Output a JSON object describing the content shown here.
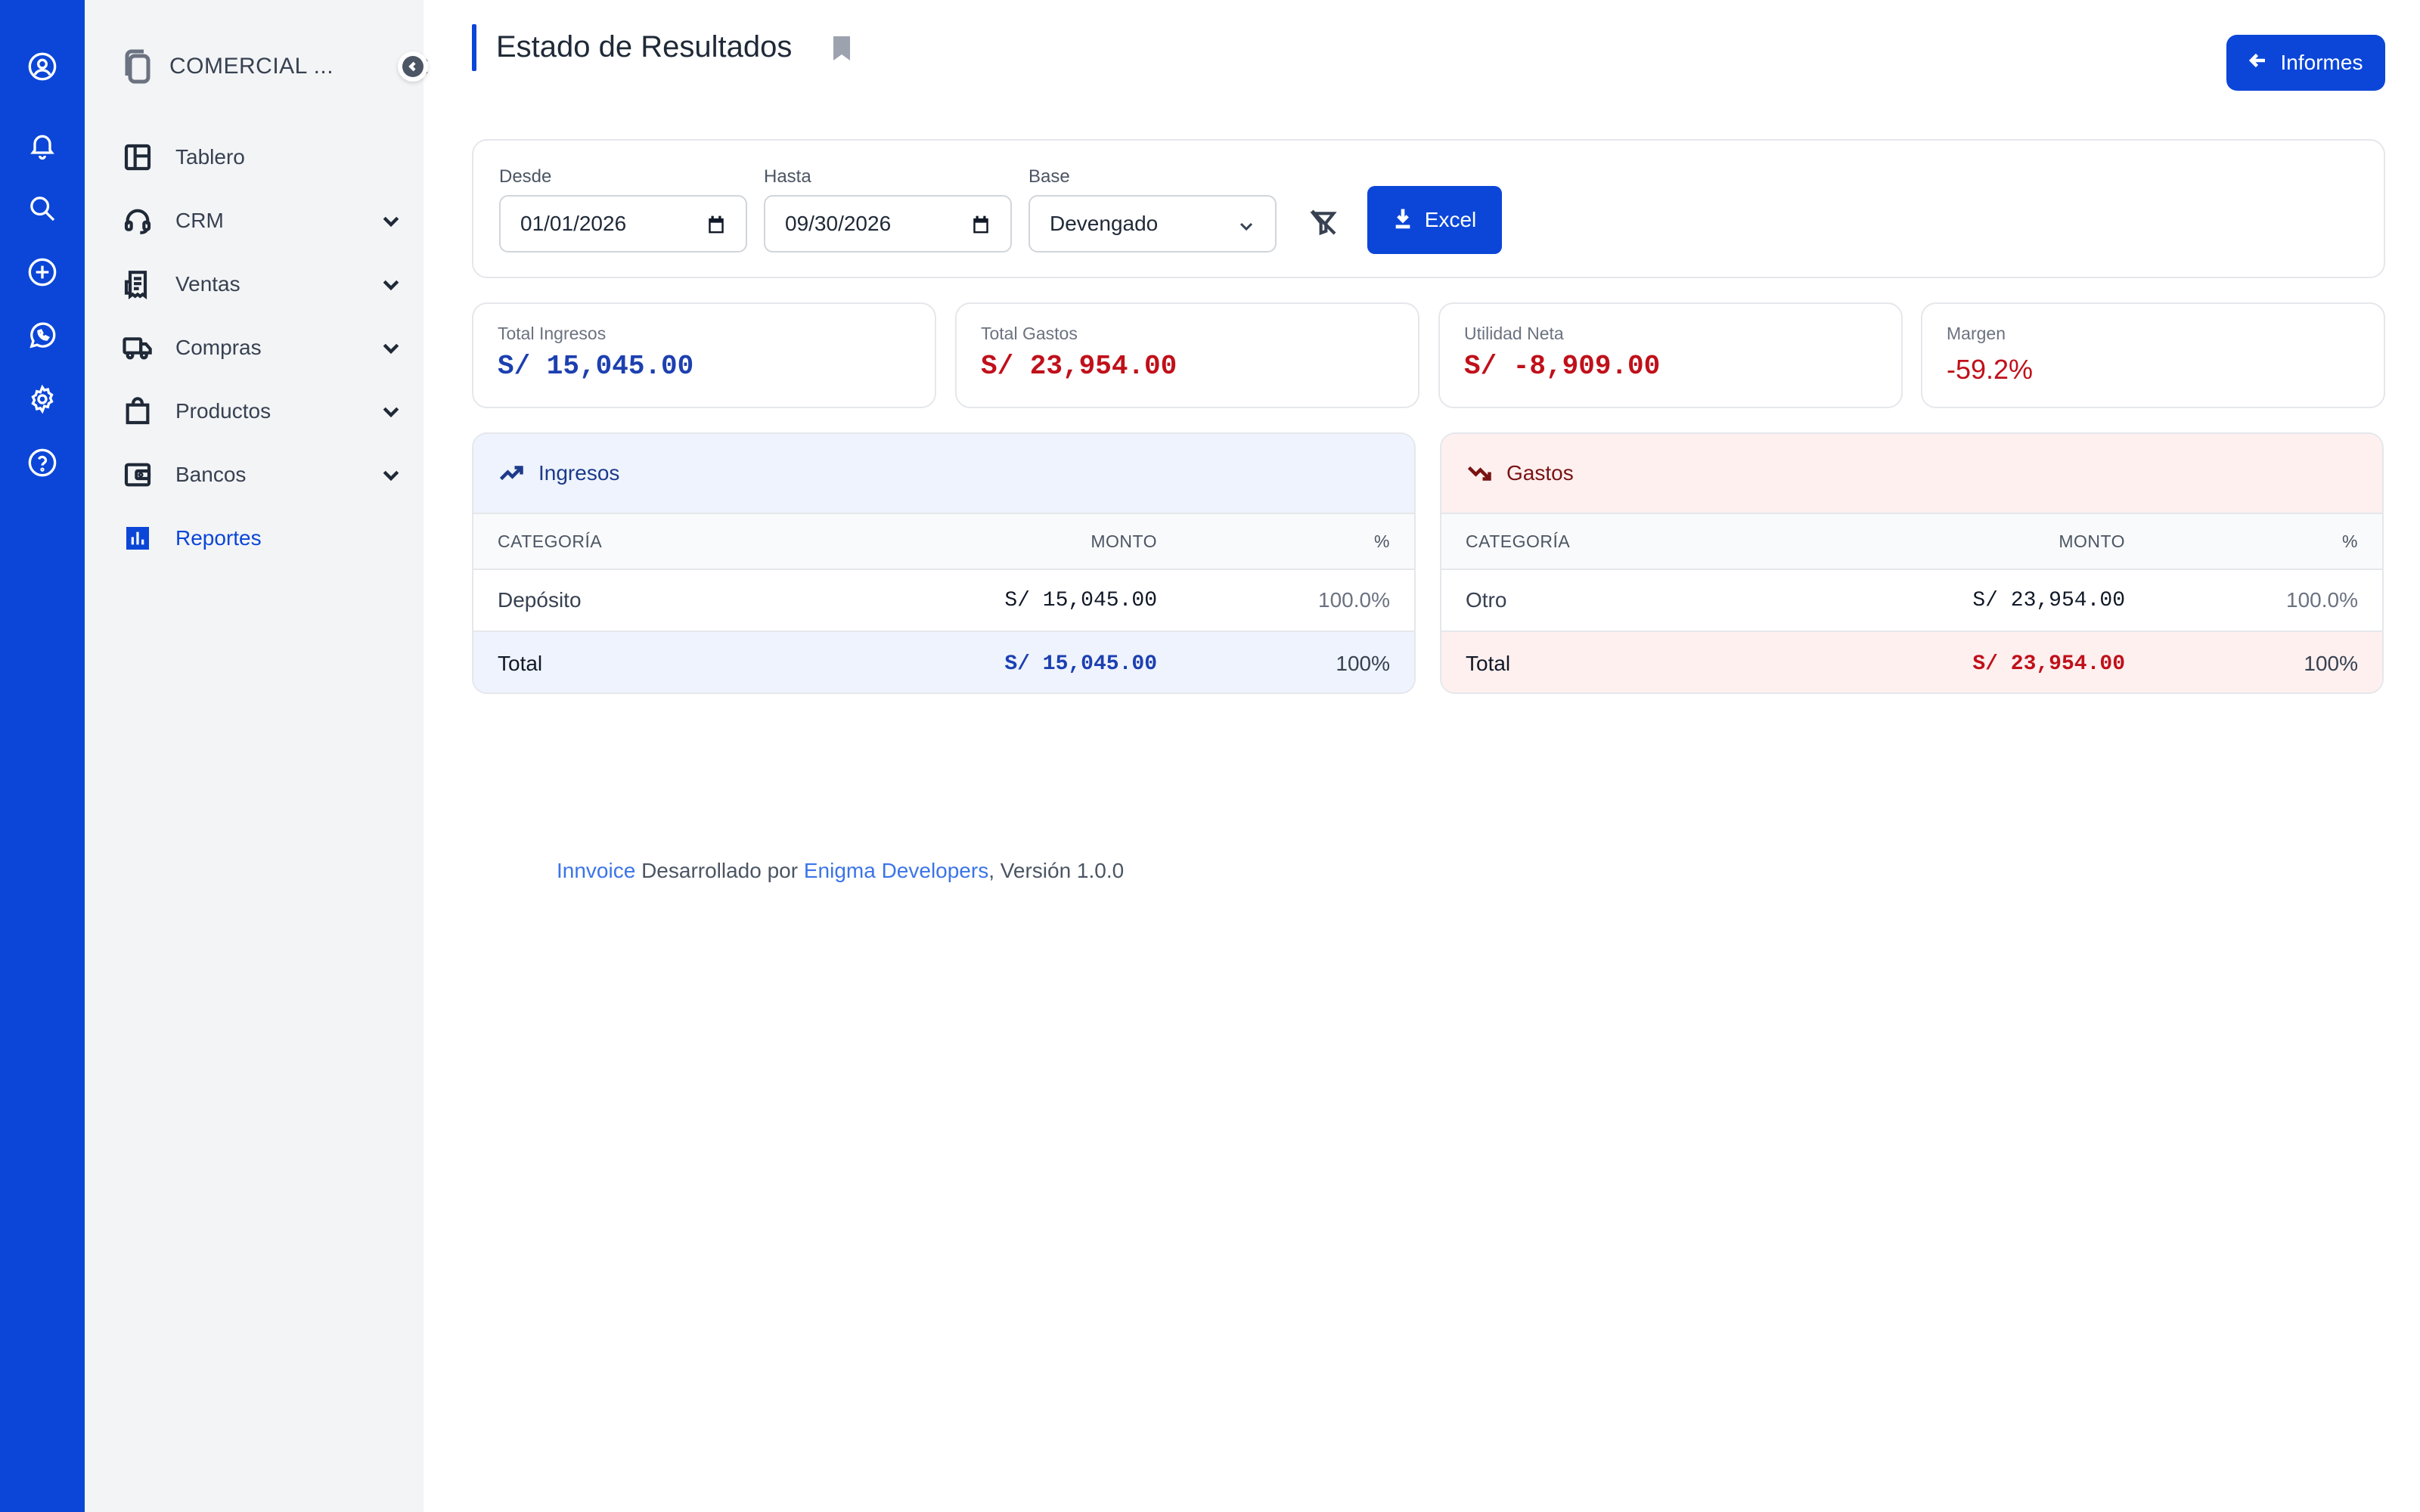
{
  "colors": {
    "brand": "#0b46d8",
    "income": "#1d40b0",
    "expense": "#c0101a",
    "income_bg": "#eef3fd",
    "expense_bg": "#fdf0ef"
  },
  "rail": {
    "icons": [
      "user-circle-icon",
      "bell-icon",
      "search-icon",
      "plus-circle-icon",
      "whatsapp-icon",
      "gear-icon",
      "help-circle-icon"
    ]
  },
  "sidebar": {
    "company": "COMERCIAL ...",
    "items": [
      {
        "label": "Tablero",
        "icon": "layout-icon",
        "expandable": false
      },
      {
        "label": "CRM",
        "icon": "headset-icon",
        "expandable": true
      },
      {
        "label": "Ventas",
        "icon": "receipt-icon",
        "expandable": true
      },
      {
        "label": "Compras",
        "icon": "truck-icon",
        "expandable": true
      },
      {
        "label": "Productos",
        "icon": "shopping-bag-icon",
        "expandable": true
      },
      {
        "label": "Bancos",
        "icon": "wallet-icon",
        "expandable": true
      },
      {
        "label": "Reportes",
        "icon": "bar-chart-icon",
        "expandable": false,
        "active": true
      }
    ]
  },
  "header": {
    "title": "Estado de Resultados",
    "back_button": "Informes"
  },
  "filters": {
    "desde_label": "Desde",
    "desde_value": "01/01/2026",
    "hasta_label": "Hasta",
    "hasta_value": "09/30/2026",
    "base_label": "Base",
    "base_value": "Devengado",
    "excel_button": "Excel"
  },
  "kpis": {
    "ingresos": {
      "label": "Total Ingresos",
      "value": "S/ 15,045.00"
    },
    "gastos": {
      "label": "Total Gastos",
      "value": "S/ 23,954.00"
    },
    "utilidad": {
      "label": "Utilidad Neta",
      "value": "S/ -8,909.00"
    },
    "margen": {
      "label": "Margen",
      "value": "-59.2%"
    }
  },
  "ingresos_table": {
    "title": "Ingresos",
    "headers": {
      "categoria": "CATEGORÍA",
      "monto": "MONTO",
      "pct": "%"
    },
    "rows": [
      {
        "categoria": "Depósito",
        "monto": "S/ 15,045.00",
        "pct": "100.0%"
      }
    ],
    "total": {
      "label": "Total",
      "monto": "S/ 15,045.00",
      "pct": "100%"
    }
  },
  "gastos_table": {
    "title": "Gastos",
    "headers": {
      "categoria": "CATEGORÍA",
      "monto": "MONTO",
      "pct": "%"
    },
    "rows": [
      {
        "categoria": "Otro",
        "monto": "S/ 23,954.00",
        "pct": "100.0%"
      }
    ],
    "total": {
      "label": "Total",
      "monto": "S/ 23,954.00",
      "pct": "100%"
    }
  },
  "footer": {
    "app_link": "Innvoice",
    "developed_by": " Desarrollado por ",
    "dev_link": "Enigma Developers",
    "version": ", Versión 1.0.0"
  }
}
